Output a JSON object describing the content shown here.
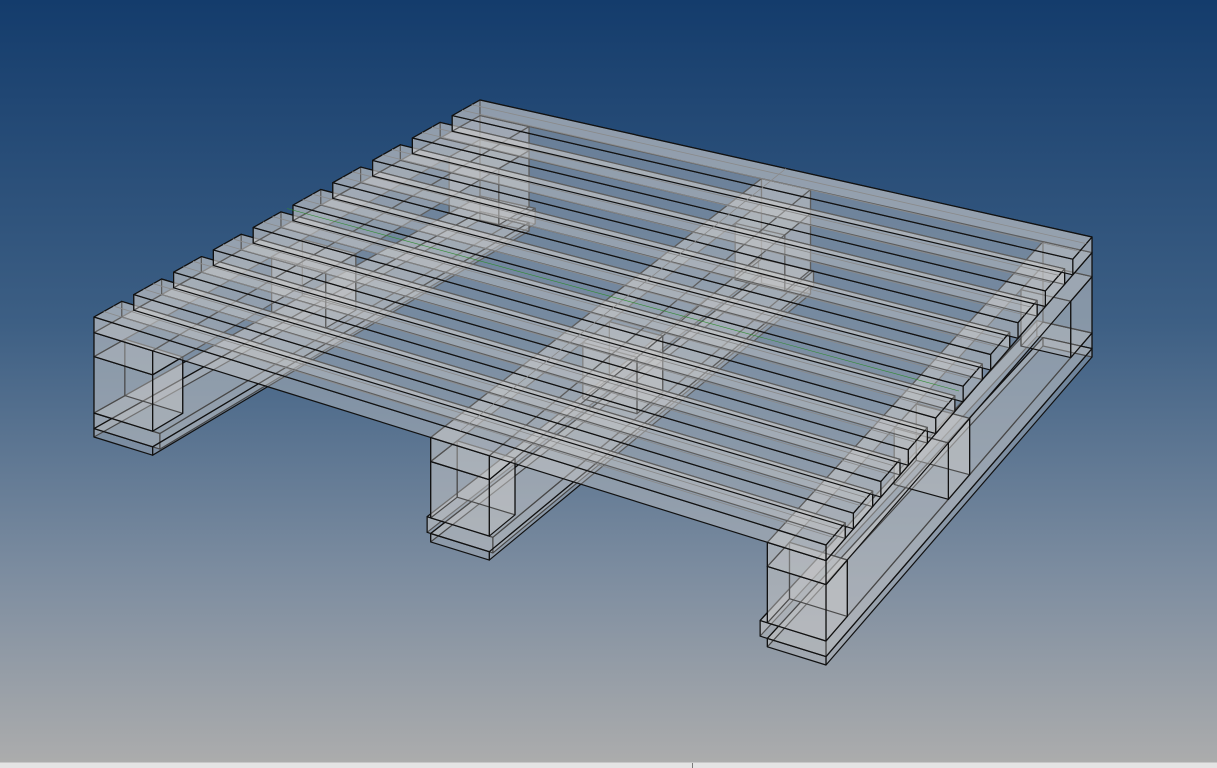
{
  "viewport": {
    "background_top": "#143c6c",
    "background_bottom": "#adadad",
    "projection": "perspective",
    "display_mode": "ghosted"
  },
  "model": {
    "type": "pallet",
    "deck_boards": 10,
    "stringers": 3,
    "blocks_per_stringer": 3,
    "bottom_boards": 3,
    "surface_color": "#c8c8c8",
    "edge_color": "#111111",
    "hidden_edge_color": "#8a8a8a",
    "selected_edge_color": "#2e8b2e"
  }
}
